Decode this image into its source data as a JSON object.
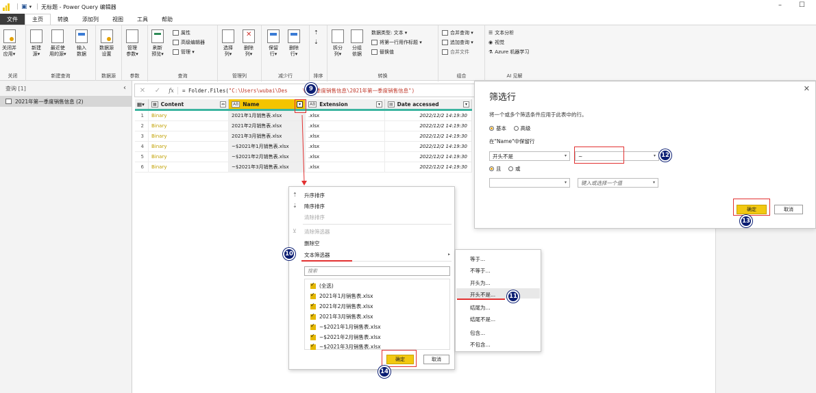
{
  "window": {
    "title": "无标题 - Power Query 编辑器",
    "minimize": "–",
    "maximize": "☐"
  },
  "tabs": [
    "文件",
    "主页",
    "转换",
    "添加列",
    "视图",
    "工具",
    "帮助"
  ],
  "ribbon": {
    "groups": [
      {
        "label": "关闭",
        "buttons": [
          "关闭并\n应用▾"
        ]
      },
      {
        "label": "新建查询",
        "buttons": [
          "新建\n源▾",
          "最近使\n用的源▾",
          "输入\n数据"
        ]
      },
      {
        "label": "数据源",
        "buttons": [
          "数据源\n设置"
        ]
      },
      {
        "label": "参数",
        "buttons": [
          "管理\n参数▾"
        ]
      },
      {
        "label": "查询",
        "buttons": [
          "刷新\n预览▾"
        ],
        "small": [
          "属性",
          "高级编辑器",
          "管理 ▾"
        ]
      },
      {
        "label": "管理列",
        "buttons": [
          "选择\n列▾",
          "删除\n列▾"
        ]
      },
      {
        "label": "减少行",
        "buttons": [
          "保留\n行▾",
          "删除\n行▾"
        ]
      },
      {
        "label": "排序",
        "buttons": []
      },
      {
        "label": "转换",
        "buttons": [
          "拆分\n列▾",
          "分组\n依据"
        ],
        "small": [
          "数据类型: 文本 ▾",
          "将第一行用作标题 ▾",
          "替换值"
        ]
      },
      {
        "label": "组合",
        "small": [
          "合并查询 ▾",
          "追加查询 ▾",
          "合并文件"
        ]
      },
      {
        "label": "AI 见解",
        "small": [
          "文本分析",
          "视觉",
          "Azure 机器学习"
        ]
      }
    ]
  },
  "queries": {
    "header": "查询 [1]",
    "collapse": "‹",
    "items": [
      "2021年第一季度销售信息 (2)"
    ]
  },
  "formula": {
    "cancel": "✕",
    "commit": "✓",
    "fx": "fx",
    "prefix": "= Folder.Files(",
    "string_a": "\"C:\\Users\\wubai\\Des",
    "string_b": "\\第一季度销售信息\\2021年第一季度销售信息\")"
  },
  "grid": {
    "columns": [
      {
        "type": "▦",
        "name": "Content",
        "dd": "⇔"
      },
      {
        "type": "AB",
        "name": "Name",
        "dd": "▾"
      },
      {
        "type": "AB",
        "name": "Extension",
        "dd": "▾"
      },
      {
        "type": "▤",
        "name": "Date accessed",
        "dd": "▾"
      }
    ],
    "rows": [
      {
        "n": "1",
        "content": "Binary",
        "name": "2021年1月销售表.xlsx",
        "ext": ".xlsx",
        "date": "2022/12/2 14:19:30"
      },
      {
        "n": "2",
        "content": "Binary",
        "name": "2021年2月销售表.xlsx",
        "ext": ".xlsx",
        "date": "2022/12/2 14:19:30"
      },
      {
        "n": "3",
        "content": "Binary",
        "name": "2021年3月销售表.xlsx",
        "ext": ".xlsx",
        "date": "2022/12/2 14:19:30"
      },
      {
        "n": "4",
        "content": "Binary",
        "name": "~$2021年1月销售表.xlsx",
        "ext": ".xlsx",
        "date": "2022/12/2 14:19:30"
      },
      {
        "n": "5",
        "content": "Binary",
        "name": "~$2021年2月销售表.xlsx",
        "ext": ".xlsx",
        "date": "2022/12/2 14:19:30"
      },
      {
        "n": "6",
        "content": "Binary",
        "name": "~$2021年3月销售表.xlsx",
        "ext": ".xlsx",
        "date": "2022/12/2 14:19:30"
      }
    ]
  },
  "menu": {
    "sort_asc": "升序排序",
    "sort_desc": "降序排序",
    "clear_sort": "清除排序",
    "clear_filter": "清除筛选器",
    "remove_empty": "删除空",
    "text_filters": "文本筛选器",
    "search_placeholder": "搜索",
    "items": [
      "(全选)",
      "2021年1月销售表.xlsx",
      "2021年2月销售表.xlsx",
      "2021年3月销售表.xlsx",
      "~$2021年1月销售表.xlsx",
      "~$2021年2月销售表.xlsx",
      "~$2021年3月销售表.xlsx"
    ],
    "ok": "确定",
    "cancel": "取消"
  },
  "submenu": [
    "等于...",
    "不等于...",
    "开头为...",
    "开头不是...",
    "结尾为...",
    "结尾不是...",
    "包含...",
    "不包含..."
  ],
  "dialog": {
    "title": "筛选行",
    "desc": "将一个或多个筛选条件应用于此表中的行。",
    "basic": "基本",
    "advanced": "高级",
    "keep_label": "在\"Name\"中保留行",
    "op1": "开头不是",
    "val1": "~",
    "and": "且",
    "or": "或",
    "op2": "",
    "val2_placeholder": "键入或选择一个值",
    "ok": "确定",
    "cancel": "取消",
    "close": "✕"
  },
  "markers": [
    "9",
    "10",
    "11",
    "12",
    "13",
    "14"
  ]
}
